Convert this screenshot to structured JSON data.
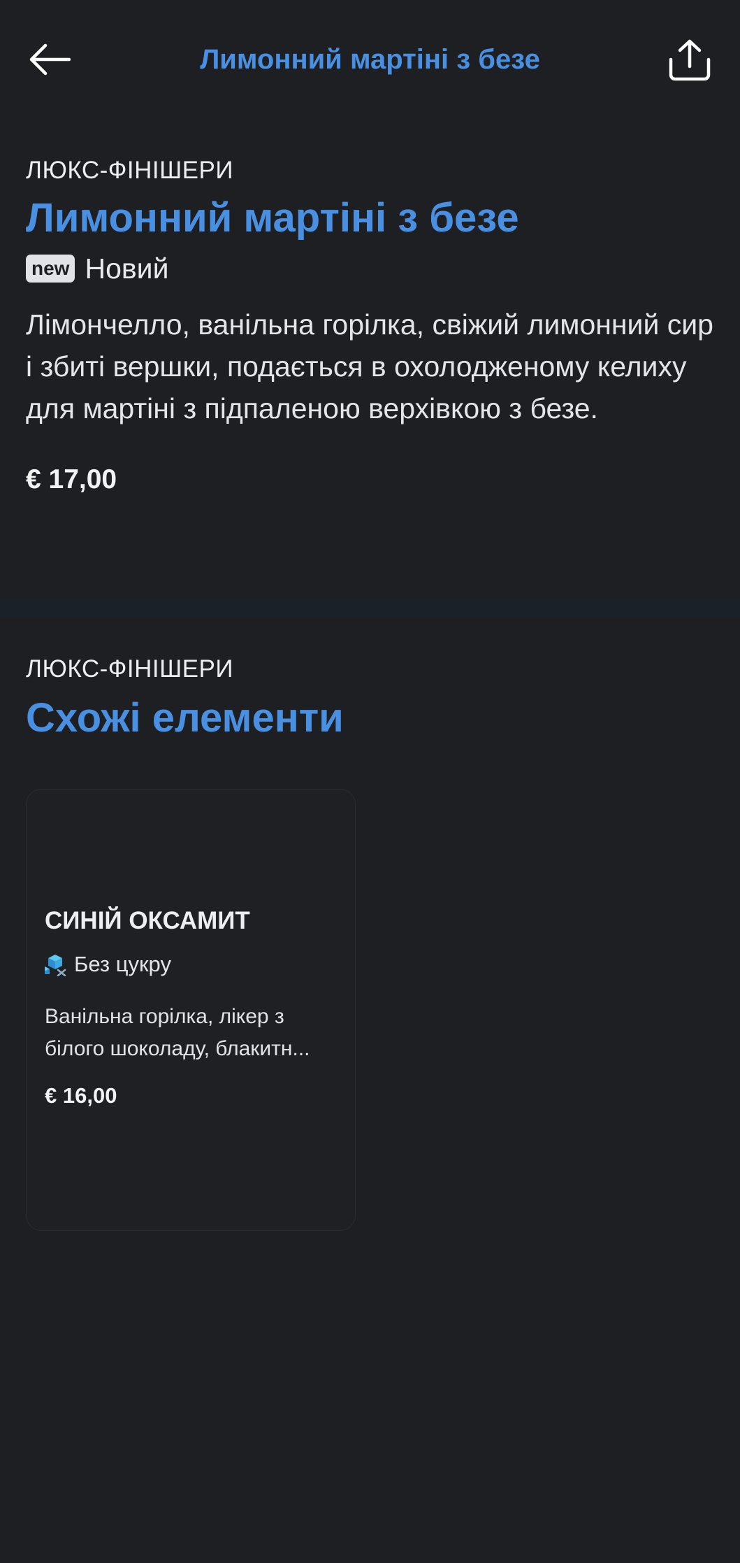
{
  "header": {
    "title": "Лимонний мартіні з безе",
    "back_icon": "arrow-left-icon",
    "share_icon": "share-icon"
  },
  "item": {
    "category": "ЛЮКС-ФІНІШЕРИ",
    "title": "Лимонний мартіні з безе",
    "badge": "new",
    "badge_label": "Новий",
    "description": "Лімончелло, ванільна горілка, свіжий лимонний сир і збиті вершки, подається в охолодженому келиху для мартіні з підпаленою верхівкою з безе.",
    "price": "€ 17,00"
  },
  "similar": {
    "category": "ЛЮКС-ФІНІШЕРИ",
    "title": "Схожі елементи",
    "items": [
      {
        "name": "СИНІЙ ОКСАМИТ",
        "tag_icon": "sugar-free-icon",
        "tag": "Без цукру",
        "description": "Ванільна горілка, лікер з білого шоколаду, блакитн...",
        "price": "€ 16,00"
      }
    ]
  },
  "colors": {
    "background": "#1e1f22",
    "accent": "#4a90e2",
    "divider": "#1a2129"
  }
}
